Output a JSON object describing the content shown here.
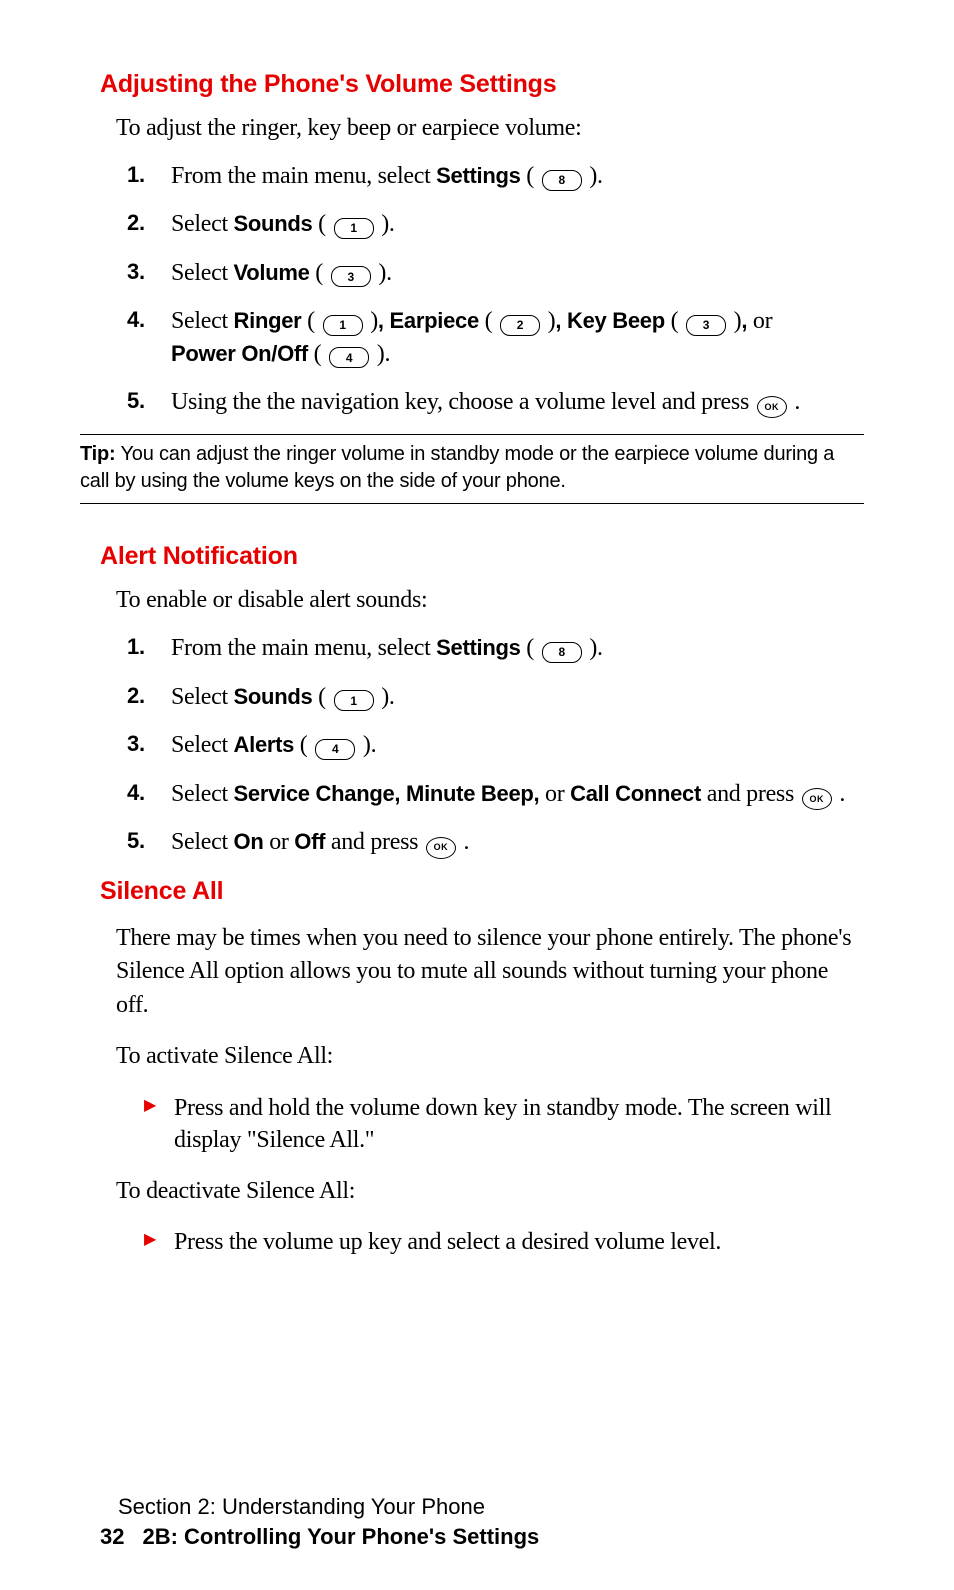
{
  "section1": {
    "heading": "Adjusting the Phone's Volume Settings",
    "intro": "To adjust the ringer, key beep or earpiece volume:",
    "step1_a": "From the main menu, select ",
    "step1_b": "Settings",
    "step1_key": "8",
    "step2_a": "Select ",
    "step2_b": "Sounds",
    "step2_key": "1",
    "step3_a": "Select ",
    "step3_b": "Volume",
    "step3_key": "3",
    "step4_a": "Select ",
    "step4_b1": "Ringer",
    "step4_k1": "1",
    "step4_b2": "Earpiece",
    "step4_k2": "2",
    "step4_b3": "Key Beep",
    "step4_k3": "3",
    "step4_or": " or ",
    "step4_b4": "Power On/Off",
    "step4_k4": "4",
    "step5_a": "Using the the navigation key, choose a volume level and press ",
    "step5_ok": "OK"
  },
  "tip": {
    "label": "Tip:",
    "text": " You can adjust the ringer volume in standby mode or the earpiece volume during a call by using the volume keys on the side of your phone."
  },
  "section2": {
    "heading": "Alert Notification",
    "intro": "To enable or disable alert sounds:",
    "step1_a": "From the main menu, select ",
    "step1_b": "Settings",
    "step1_key": "8",
    "step2_a": "Select ",
    "step2_b": "Sounds",
    "step2_key": "1",
    "step3_a": "Select ",
    "step3_b": "Alerts",
    "step3_key": "4",
    "step4_a": "Select ",
    "step4_b1": "Service Change, Minute Beep,",
    "step4_mid": " or ",
    "step4_b2": "Call Connect",
    "step4_c": " and press ",
    "step4_ok": "OK",
    "step5_a": "Select ",
    "step5_b1": "On",
    "step5_mid": " or ",
    "step5_b2": "Off",
    "step5_c": " and press ",
    "step5_ok": "OK"
  },
  "section3": {
    "heading": "Silence All",
    "para1": "There may be times when you need to silence your phone entirely. The phone's Silence All option allows you to mute all sounds without turning your phone off.",
    "para2": "To activate Silence All:",
    "bullet1": "Press and hold the volume down key in standby mode. The screen will display \"Silence All.\"",
    "para3": "To deactivate Silence All:",
    "bullet2": "Press the volume up key and select a desired volume level."
  },
  "footer": {
    "section_path": "Section 2: Understanding Your Phone",
    "page_num": "32",
    "chapter": "2B: Controlling Your Phone's Settings"
  }
}
